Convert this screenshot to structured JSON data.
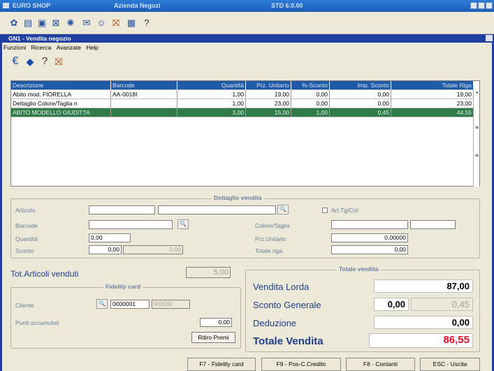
{
  "outer_window": {
    "app_name": "EURO SHOP",
    "company": "Azienda Negozi",
    "version": "STD 6.0.00"
  },
  "inner_window": {
    "title": "GN1 - Vendita negozio"
  },
  "menu": [
    "Funzioni",
    "Ricerca",
    "Avanzate",
    "Help"
  ],
  "toolbar_icons": [
    "euro-icon",
    "arrows-icon",
    "help-icon",
    "exit-door-icon"
  ],
  "grid": {
    "headers": [
      "Descrizione",
      "Barcode",
      "Quantità",
      "Prz. Unitario",
      "%-Sconto",
      "Imp. Sconto",
      "Totale Riga"
    ],
    "rows": [
      [
        "Abito mod. FIORELLA",
        "AA-0018I",
        "1,00",
        "19,00",
        "0,00",
        "0,00",
        "19,00"
      ],
      [
        "Dettaglio Colore/Taglia n",
        "",
        "1,00",
        "23,00",
        "0,00",
        "0,00",
        "23,00"
      ],
      [
        "ABITO MODELLO GIUDITTA",
        "",
        "3,00",
        "15,00",
        "1,00",
        "0,45",
        "44,55"
      ]
    ]
  },
  "dettaglio": {
    "title": "Dettaglio vendita",
    "articolo_label": "Articolo",
    "barcode_label": "Barcode",
    "quantita_label": "Quantità",
    "sconto_label": "Sconto",
    "quantita_value": "0,00",
    "sconto_value": "0,00",
    "sconto_value2": "0,00",
    "art_tg_col_label": "Art.Tg/Col",
    "colore_taglia_label": "Colore/Taglia",
    "prz_unitario_label": "Prz.Unitario",
    "prz_unitario_value": "0,00000",
    "totale_riga_label": "Totale riga",
    "totale_riga_value": "0,00"
  },
  "tot_articoli": {
    "label": "Tot.Articoli venduti",
    "value": "5,00"
  },
  "fidelity": {
    "title": "Fidelity card",
    "cliente_label": "Cliente",
    "cliente_code": "0000001",
    "cliente_name": "ROSSI",
    "punti_label": "Punti accumulati",
    "punti_value": "0,00",
    "ritiro_button": "Ritiro Premi"
  },
  "totale_vendita": {
    "title": "Totale vendita",
    "lorda_label": "Vendita Lorda",
    "lorda_value": "87,00",
    "sconto_label": "Sconto Generale",
    "sconto_pct": "0,00",
    "sconto_value": "0,45",
    "deduzione_label": "Deduzione",
    "deduzione_value": "0,00",
    "totale_label": "Totale Vendita",
    "totale_value": "86,55"
  },
  "bottom_buttons": [
    "F7 - Fidelity card",
    "F9 - Pos-C.Credito",
    "F8 - Contanti",
    "ESC - Uscita"
  ],
  "colors": {
    "title_blue": "#1e3fa0",
    "selected_row": "#2f7c48",
    "total_red": "#e0102a"
  }
}
